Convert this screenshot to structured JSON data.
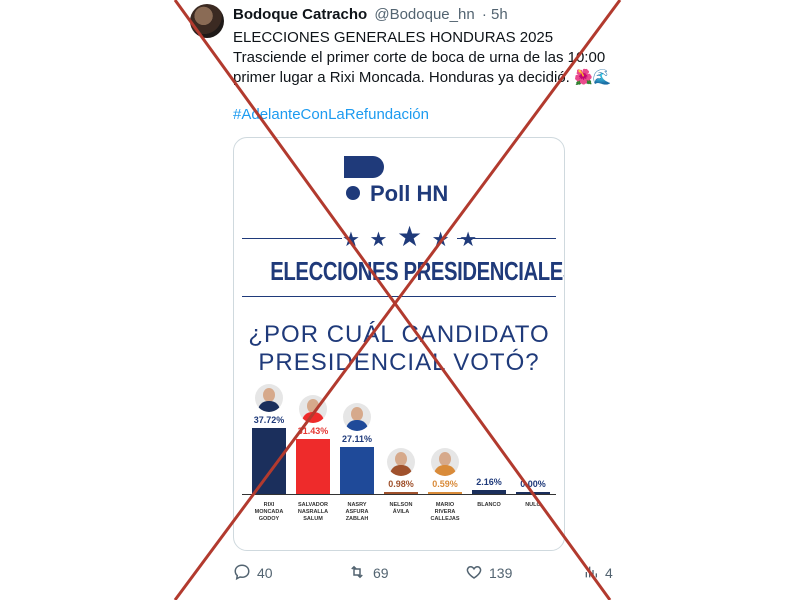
{
  "tweet": {
    "name": "Bodoque Catracho",
    "handle": "@Bodoque_hn",
    "time": "· 5h",
    "lines": [
      "ELECCIONES GENERALES HONDURAS 2025",
      "Trasciende el primer corte de boca de urna de las 10:00",
      "primer lugar a Rixi Moncada. Honduras ya decidió. 🌺🌊"
    ],
    "hashtag": "#AdelanteConLaRefundación",
    "actions": {
      "replies": "40",
      "retweets": "69",
      "likes": "139",
      "views": "4"
    }
  },
  "card": {
    "logo_text": "Poll HN",
    "stars": "★ ★",
    "star_big": "★",
    "stars_after": "★ ★",
    "title": "ELECCIONES PRESIDENCIALES HN",
    "question": [
      "¿POR CUÁL CANDIDATO",
      "PRESIDENCIAL VOTÓ?"
    ]
  },
  "chart_data": {
    "type": "bar",
    "categories": [
      "RIXI MONCADA GODOY",
      "SALVADOR NASRALLA SALUM",
      "NASRY ASFURA ZABLAH",
      "NELSON ÁVILA",
      "MARIO RIVERA CALLEJAS",
      "BLANCO",
      "NULO"
    ],
    "label_lines": [
      [
        "RIXI",
        "MONCADA",
        "GODOY"
      ],
      [
        "SALVADOR",
        "NASRALLA",
        "SALUM"
      ],
      [
        "NASRY",
        "ASFURA",
        "ZABLAH"
      ],
      [
        "NELSON",
        "ÁVILA"
      ],
      [
        "MARIO",
        "RIVERA",
        "CALLEJAS"
      ],
      [
        "BLANCO"
      ],
      [
        "NULO"
      ]
    ],
    "values": [
      37.72,
      31.43,
      27.11,
      0.98,
      0.59,
      2.16,
      0.0
    ],
    "value_labels": [
      "37.72%",
      "31.43%",
      "27.11%",
      "0.98%",
      "0.59%",
      "2.16%",
      "0.00%"
    ],
    "colors": [
      "#1b2f5c",
      "#ee2b2b",
      "#1f4a99",
      "#a0522d",
      "#d98b3a",
      "#1b2f5c",
      "#1b2f5c"
    ],
    "label_colors": [
      "#1f3a7a",
      "#e53935",
      "#1f3a7a",
      "#a0522d",
      "#d98b3a",
      "#1f3a7a",
      "#1f3a7a"
    ],
    "has_photo": [
      true,
      true,
      true,
      true,
      true,
      false,
      false
    ],
    "ylim": [
      0,
      40
    ]
  },
  "overlay": {
    "color": "#b23a2e"
  }
}
